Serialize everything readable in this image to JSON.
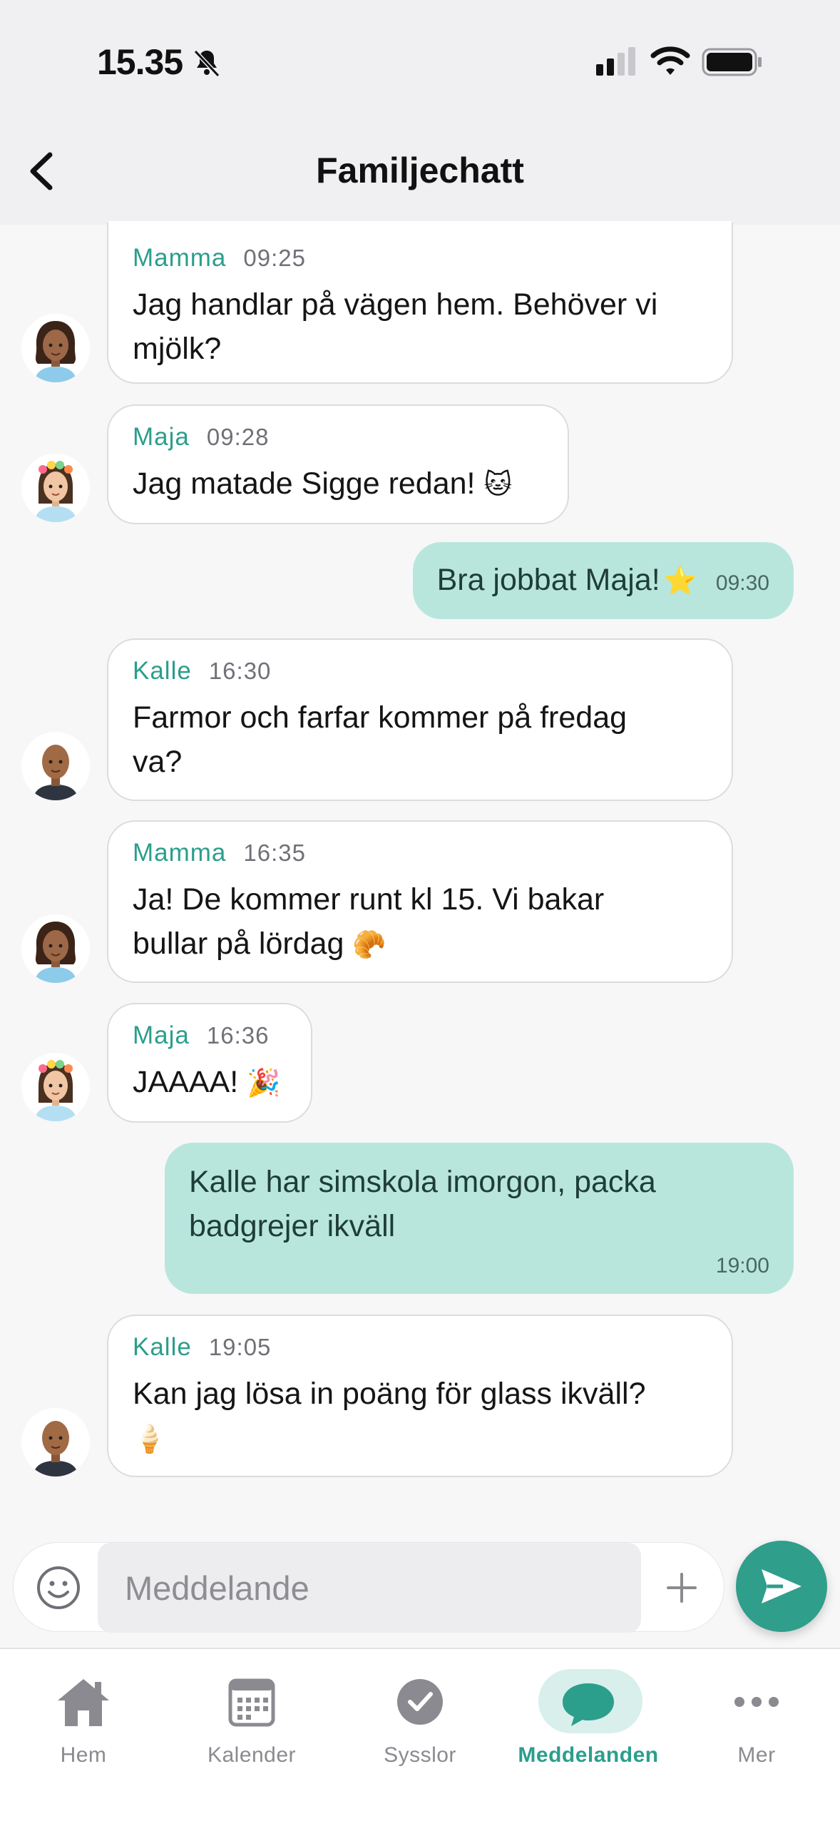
{
  "status": {
    "time": "15.35"
  },
  "header": {
    "title": "Familjechatt"
  },
  "messages": [
    {
      "sender": "Mamma",
      "time": "09:25",
      "lines": [
        "Jag handlar på vägen hem. Behöver vi",
        "mjölk?"
      ]
    },
    {
      "sender": "Maja",
      "time": "09:28",
      "text": "Jag matade Sigge redan!",
      "emoji": "🐱"
    },
    {
      "text": "Bra jobbat Maja!",
      "emoji": "⭐",
      "time": "09:30"
    },
    {
      "sender": "Kalle",
      "time": "16:30",
      "lines": [
        "Farmor och farfar kommer på fredag",
        "va?"
      ]
    },
    {
      "sender": "Mamma",
      "time": "16:35",
      "line1": "Ja! De kommer runt kl 15. Vi bakar",
      "line2": "bullar på lördag",
      "emoji": "🥐"
    },
    {
      "sender": "Maja",
      "time": "16:36",
      "text": "JAAAA!",
      "emoji": "🎉"
    },
    {
      "lines": [
        "Kalle har simskola imorgon, packa",
        "badgrejer ikväll"
      ],
      "time": "19:00"
    },
    {
      "sender": "Kalle",
      "time": "19:05",
      "text": "Kan jag lösa in poäng för glass ikväll?",
      "emoji": "🍦"
    }
  ],
  "composer": {
    "placeholder": "Meddelande"
  },
  "tabs": [
    {
      "label": "Hem",
      "icon": "house-icon"
    },
    {
      "label": "Kalender",
      "icon": "calendar-icon"
    },
    {
      "label": "Sysslor",
      "icon": "checkmark-circle-icon"
    },
    {
      "label": "Meddelanden",
      "icon": "chat-bubble-icon",
      "active": true
    },
    {
      "label": "Mer",
      "icon": "more-dots-icon"
    }
  ],
  "colors": {
    "accent": "#2b9e8c",
    "outgoing_bubble": "#b8e6dd",
    "send_button": "#2f9e8b"
  }
}
